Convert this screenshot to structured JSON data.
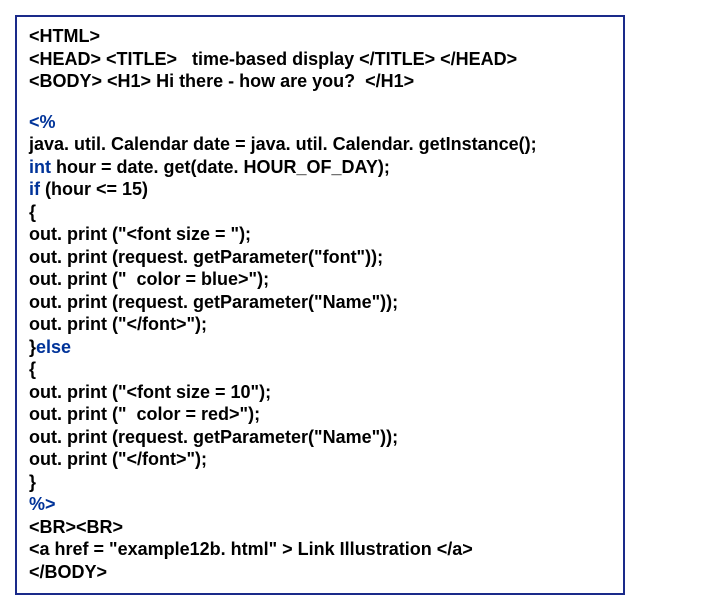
{
  "lines": {
    "l01": "<HTML>",
    "l02a": "<HEAD> <TITLE>   time-based display </TITLE> </HEAD>",
    "l03": "<BODY> <H1> Hi there - how are you?  </H1>",
    "l04a": "<%",
    "l05": "java. util. Calendar date = java. util. Calendar. getInstance();",
    "l06a": "int",
    "l06b": " hour = date. get(date. HOUR_OF_DAY);",
    "l07a": "if",
    "l07b": " (hour <= 15)",
    "l08": "{",
    "l09": "out. print (\"<font size = \");",
    "l10": "out. print (request. getParameter(\"font\"));",
    "l11": "out. print (\"  color = blue>\");",
    "l12": "out. print (request. getParameter(\"Name\"));",
    "l13": "out. print (\"</font>\");",
    "l14a": "}",
    "l14b": "else",
    "l15": "{",
    "l16": "out. print (\"<font size = 10\");",
    "l17": "out. print (\"  color = red>\");",
    "l18": "out. print (request. getParameter(\"Name\"));",
    "l19": "out. print (\"</font>\");",
    "l20": "}",
    "l21a": "%>",
    "l22": "<BR><BR>",
    "l23": "<a href = \"example12b. html\" > Link Illustration </a>",
    "l24": "</BODY>"
  }
}
